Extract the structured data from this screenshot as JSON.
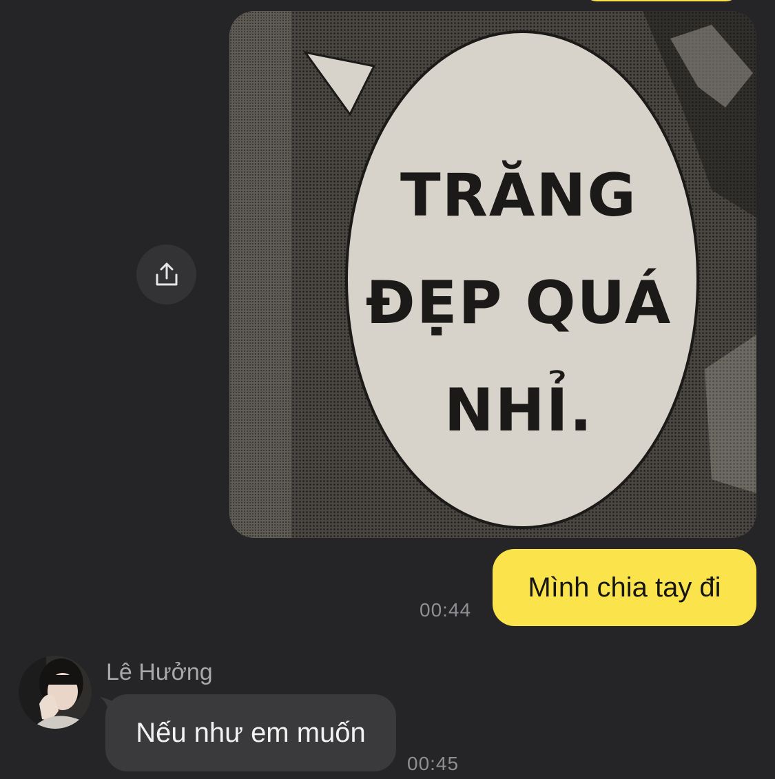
{
  "colors": {
    "background": "#252527",
    "sent_bubble": "#fbe34b",
    "received_bubble": "#3a3a3d",
    "timestamp": "#8f8f93"
  },
  "image_message": {
    "lines": [
      "TRĂNG",
      "ĐẸP QUÁ",
      "NHỈ."
    ]
  },
  "share_button": {
    "icon": "share-icon"
  },
  "messages": {
    "sent": {
      "text": "Mình chia tay đi",
      "time": "00:44"
    },
    "received": {
      "sender": "Lê Hưởng",
      "text": "Nếu như em muốn",
      "time": "00:45"
    }
  }
}
